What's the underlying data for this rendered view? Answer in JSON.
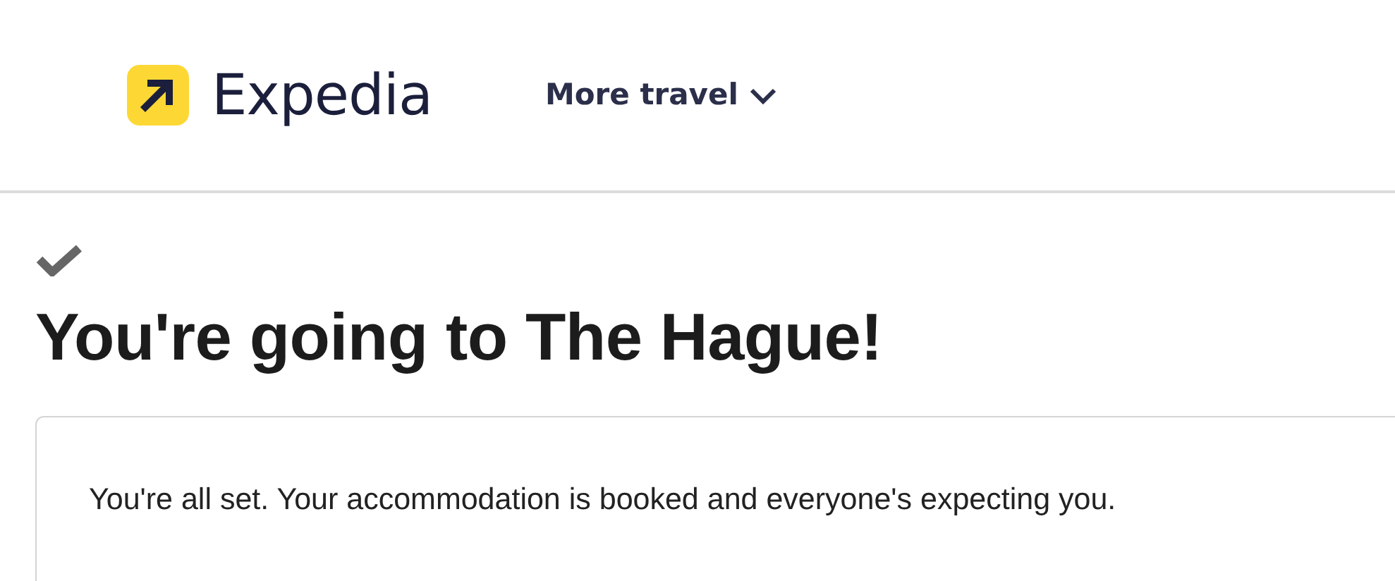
{
  "header": {
    "logo_text": "Expedia",
    "menu": {
      "label": "More travel",
      "expanded": false
    }
  },
  "confirmation": {
    "heading": "You're going to The Hague!",
    "message": "You're all set. Your accommodation is booked and everyone's expecting you."
  }
}
